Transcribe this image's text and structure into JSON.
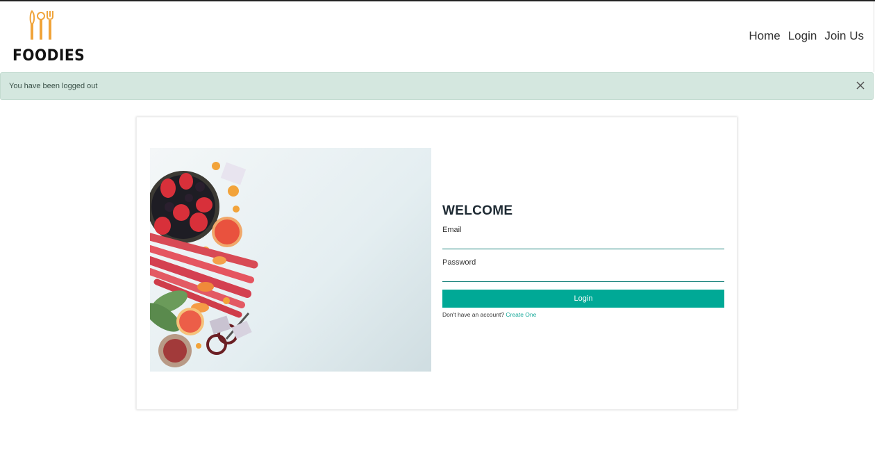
{
  "brand": {
    "name": "FOODIES",
    "icon": "utensils-icon",
    "color": "#f0a43a"
  },
  "nav": {
    "home": "Home",
    "login": "Login",
    "join": "Join Us"
  },
  "alert": {
    "message": "You have been logged out",
    "close_icon": "close-icon"
  },
  "login_form": {
    "title": "WELCOME",
    "email_label": "Email",
    "password_label": "Password",
    "submit_label": "Login",
    "signup_prompt": "Don't have an account?",
    "signup_link": "Create One"
  },
  "colors": {
    "accent": "#00a996",
    "alert_bg": "#d4e7df",
    "underline": "#17807a"
  }
}
